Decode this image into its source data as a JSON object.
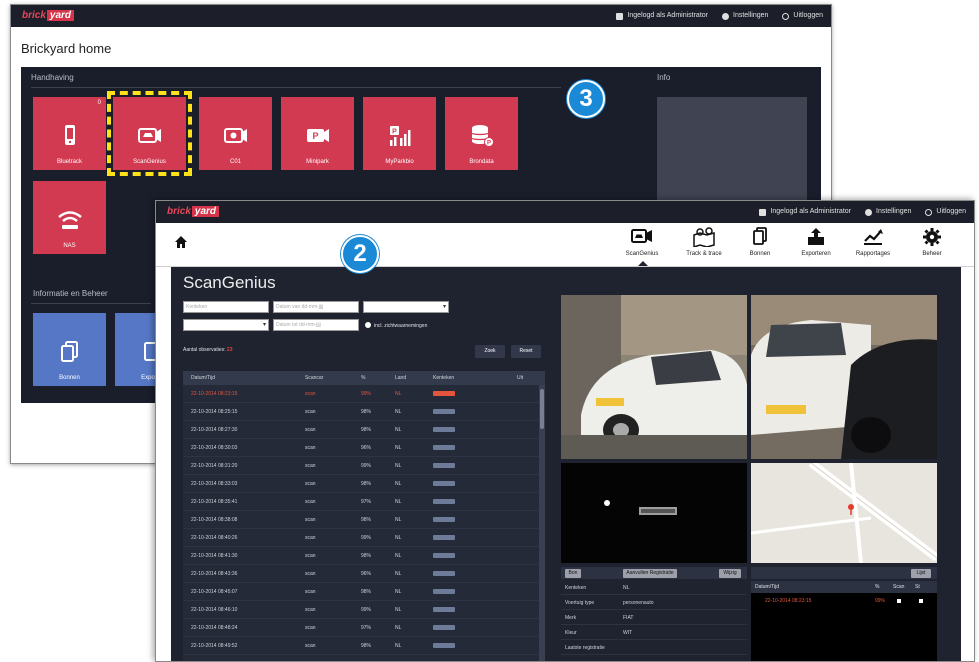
{
  "back_window": {
    "logo": {
      "brick": "brick",
      "yard": "yard"
    },
    "topbar": {
      "login": "Ingelogd als Administrator",
      "settings": "Instellingen",
      "logout": "Uitloggen"
    },
    "title": "Brickyard home",
    "section_enforcement": "Handhaving",
    "section_info": "Info",
    "section_management": "Informatie en Beheer",
    "tiles": [
      {
        "label": "Bluetrack",
        "badge": "0"
      },
      {
        "label": "ScanGenius"
      },
      {
        "label": "C01"
      },
      {
        "label": "Minipark"
      },
      {
        "label": "MyParkbio"
      },
      {
        "label": "Brondata"
      },
      {
        "label": "NAS"
      }
    ],
    "mgmt_tiles": [
      {
        "label": "Bonnen"
      },
      {
        "label": "Exporte"
      }
    ]
  },
  "badges": {
    "step3": "3",
    "step2": "2"
  },
  "front_window": {
    "logo": {
      "brick": "brick",
      "yard": "yard"
    },
    "topbar": {
      "login": "Ingelogd als Administrator",
      "settings": "Instellingen",
      "logout": "Uitloggen"
    },
    "nav": [
      {
        "label": "ScanGenius"
      },
      {
        "label": "Track & trace"
      },
      {
        "label": "Bonnen"
      },
      {
        "label": "Exporteren"
      },
      {
        "label": "Rapportages"
      },
      {
        "label": "Beheer"
      }
    ],
    "page_title": "ScanGenius",
    "filters": {
      "plate_placeholder": "Kenteken",
      "date_from_placeholder": "Datum van dd-mm-jjjj",
      "date_to_placeholder": "Datum tot dd-mm-jjjj",
      "radio_label": "incl. zichtwaarnemingen",
      "count_label": "Aantal observaties:",
      "count_value": "23"
    },
    "buttons": {
      "search": "Zoek",
      "reset": "Reset"
    },
    "table": {
      "headers": [
        "Datum/Tijd",
        "Scancar",
        "%",
        "Land",
        "Kenteken",
        "Uit"
      ],
      "rows": [
        {
          "dt": "22-10-2014 08:23:15",
          "car": "scan",
          "pct": "99%",
          "land": "NL"
        },
        {
          "dt": "22-10-2014 08:25:15",
          "car": "scan",
          "pct": "98%",
          "land": "NL"
        },
        {
          "dt": "22-10-2014 08:27:30",
          "car": "scan",
          "pct": "98%",
          "land": "NL"
        },
        {
          "dt": "22-10-2014 08:30:03",
          "car": "scan",
          "pct": "96%",
          "land": "NL"
        },
        {
          "dt": "22-10-2014 08:31:20",
          "car": "scan",
          "pct": "99%",
          "land": "NL"
        },
        {
          "dt": "22-10-2014 08:33:03",
          "car": "scan",
          "pct": "98%",
          "land": "NL"
        },
        {
          "dt": "22-10-2014 08:35:41",
          "car": "scan",
          "pct": "97%",
          "land": "NL"
        },
        {
          "dt": "22-10-2014 08:38:08",
          "car": "scan",
          "pct": "98%",
          "land": "NL"
        },
        {
          "dt": "22-10-2014 08:40:26",
          "car": "scan",
          "pct": "99%",
          "land": "NL"
        },
        {
          "dt": "22-10-2014 08:41:30",
          "car": "scan",
          "pct": "98%",
          "land": "NL"
        },
        {
          "dt": "22-10-2014 08:43:36",
          "car": "scan",
          "pct": "96%",
          "land": "NL"
        },
        {
          "dt": "22-10-2014 08:45:07",
          "car": "scan",
          "pct": "98%",
          "land": "NL"
        },
        {
          "dt": "22-10-2014 08:46:10",
          "car": "scan",
          "pct": "99%",
          "land": "NL"
        },
        {
          "dt": "22-10-2014 08:48:24",
          "car": "scan",
          "pct": "97%",
          "land": "NL"
        },
        {
          "dt": "22-10-2014 08:49:52",
          "car": "scan",
          "pct": "98%",
          "land": "NL"
        },
        {
          "dt": "22-10-2014 08:52:04",
          "car": "scan",
          "pct": "98%",
          "land": "NL"
        }
      ]
    },
    "detail": {
      "btn_left": "Bon",
      "btn_mid": "Aanvullen Registratie",
      "btn_right": "Wijzig",
      "btn_list": "Lijst",
      "rows": [
        {
          "k": "Kenteken",
          "v": "NL"
        },
        {
          "k": "Voertuig type",
          "v": "personenauto"
        },
        {
          "k": "Merk",
          "v": "FIAT"
        },
        {
          "k": "Kleur",
          "v": "WIT"
        },
        {
          "k": "Laatste registratie"
        }
      ],
      "right_header": [
        "Datum/Tijd",
        "%",
        "Scan",
        "St"
      ],
      "right_row": {
        "dt": "22-10-2014 08:23:15",
        "pct": "99%"
      }
    }
  }
}
